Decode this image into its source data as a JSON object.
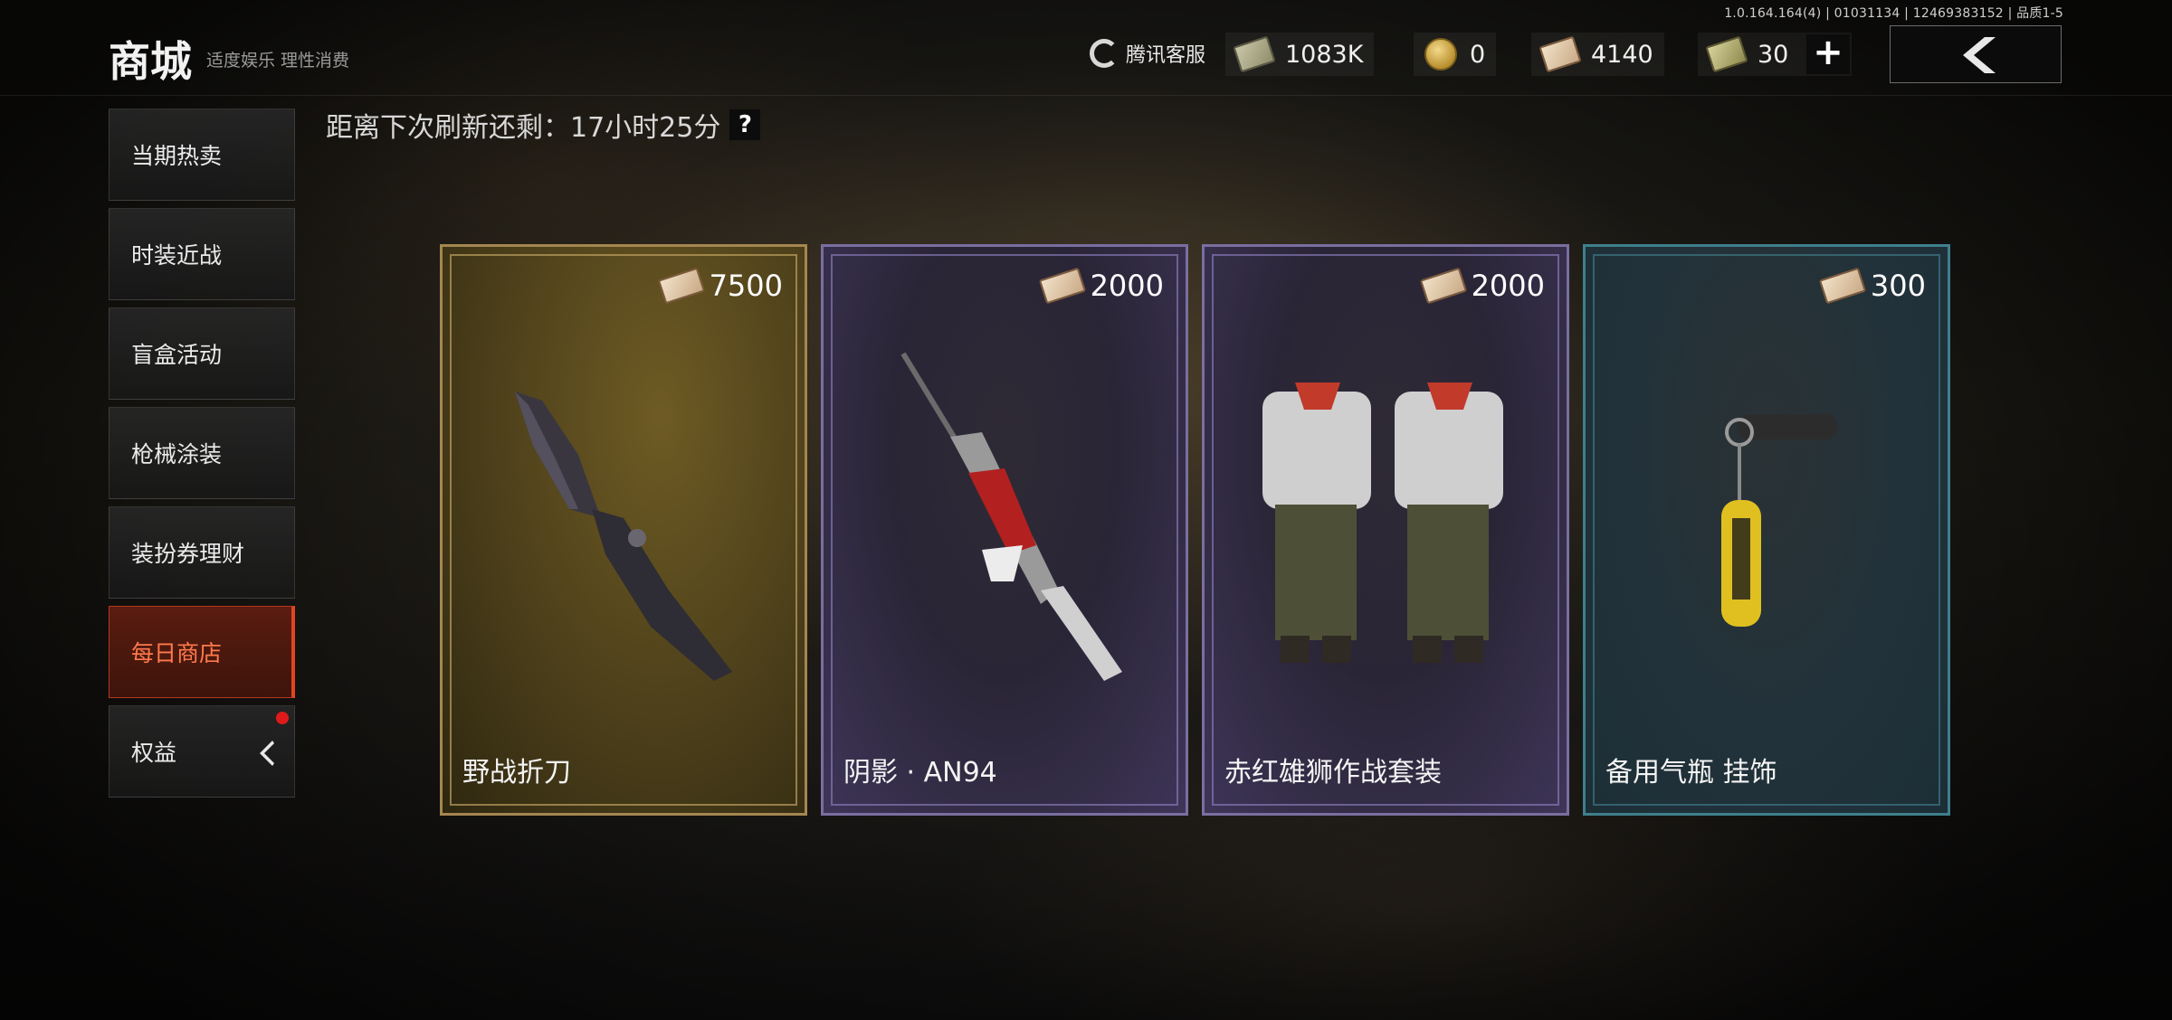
{
  "version": "1.0.164.164(4) | 01031134 | 12469383152 | 品质1-5",
  "header": {
    "title": "商城",
    "subtitle": "适度娱乐 理性消费",
    "support": "腾讯客服",
    "currencies": [
      {
        "icon": "cash-icon",
        "value": "1083K"
      },
      {
        "icon": "coin-icon",
        "value": "0"
      },
      {
        "icon": "ticket-icon",
        "value": "4140"
      },
      {
        "icon": "voucher-icon",
        "value": "30"
      }
    ]
  },
  "sidebar": {
    "items": [
      {
        "label": "当期热卖"
      },
      {
        "label": "时装近战"
      },
      {
        "label": "盲盒活动"
      },
      {
        "label": "枪械涂装"
      },
      {
        "label": "装扮券理财"
      },
      {
        "label": "每日商店",
        "active": true
      },
      {
        "label": "权益",
        "badge": true
      }
    ]
  },
  "refresh": {
    "label": "距离下次刷新还剩：17小时25分",
    "help": "?"
  },
  "cards": [
    {
      "name": "野战折刀",
      "price": "7500",
      "theme": "gold",
      "art": "knife-icon"
    },
    {
      "name": "阴影 · AN94",
      "price": "2000",
      "theme": "purple",
      "art": "rifle-icon"
    },
    {
      "name": "赤红雄狮作战套装",
      "price": "2000",
      "theme": "purple",
      "art": "outfit-icon"
    },
    {
      "name": "备用气瓶 挂饰",
      "price": "300",
      "theme": "teal",
      "art": "charm-icon"
    }
  ],
  "colors": {
    "accent": "#e24422",
    "gold_border": "#a48650",
    "purple_border": "#7a6ea0",
    "teal_border": "#3f7f8c",
    "badge": "#e01a1a"
  }
}
